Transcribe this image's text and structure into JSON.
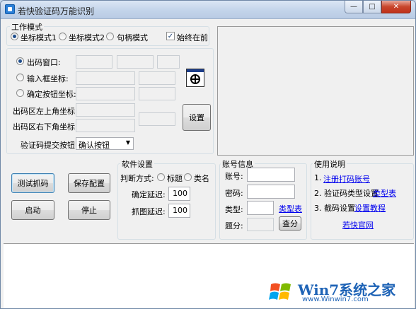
{
  "window": {
    "title": "若快验证码万能识别",
    "minimize_label": "—",
    "maximize_label": "□",
    "close_label": "✕"
  },
  "work_mode": {
    "legend": "工作模式",
    "options": [
      "坐标模式1",
      "坐标模式2",
      "句柄模式"
    ],
    "selected": "坐标模式1",
    "always_on_top_label": "始终在前",
    "always_on_top_checked": true,
    "check_mark": "✓"
  },
  "coords": {
    "captcha_window_label": "出码窗口:",
    "input_box_label": "输入框坐标:",
    "confirm_button_label": "确定按钮坐标:",
    "top_left_label": "出码区左上角坐标:",
    "bottom_right_label": "出码区右下角坐标:",
    "settings_button": "设置",
    "submit_label": "验证码提交按钮:",
    "submit_select_value": "确认按钮"
  },
  "actions": {
    "test_capture": "测试抓码",
    "save_config": "保存配置",
    "start": "启动",
    "stop": "停止"
  },
  "software_settings": {
    "legend": "软件设置",
    "judge_label": "判断方式:",
    "judge_options": [
      "标题",
      "类名"
    ],
    "confirm_delay_label": "确定延迟:",
    "confirm_delay_value": "100",
    "capture_delay_label": "抓图延迟:",
    "capture_delay_value": "100"
  },
  "account": {
    "legend": "账号信息",
    "account_label": "账号:",
    "password_label": "密码:",
    "type_label": "类型:",
    "type_table_link": "类型表",
    "points_label": "题分:",
    "query_button": "查分"
  },
  "instructions": {
    "legend": "使用说明",
    "step1_prefix": "1.",
    "step1_link": "注册打码账号",
    "step2_prefix": "2. 验证码类型设置",
    "step2_link": "类型表",
    "step3_prefix": "3. 截码设置",
    "step3_link": "设置教程",
    "official_site_link": "若快官网"
  },
  "watermark": {
    "brand": "Win7系统之家",
    "url": "www.Winwin7.com"
  }
}
